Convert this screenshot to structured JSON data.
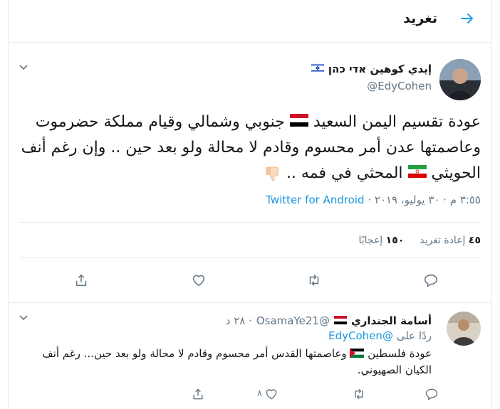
{
  "header": {
    "title": "تغريد"
  },
  "tweet": {
    "author_name": "إيدي كوهين אדי כהן",
    "author_handle": "@EdyCohen",
    "text_1": "عودة تقسيم اليمن السعيد",
    "text_2": "جنوبي وشمالي وقيام مملكة حضرموت وعاصمتها عدن أمر محسوم وقادم لا محالة ولو بعد حين .. وإن رغم أنف الحويثي",
    "text_3": "المحثي في فمه ..",
    "time": "٣:٥٥ م · ٣٠ يوليو، ٢٠١٩ ·",
    "source": "Twitter for Android",
    "retweets_count": "٤٥",
    "retweets_label": "إعادة تغريد",
    "likes_count": "١٥٠",
    "likes_label": "إعجابًا"
  },
  "reply": {
    "author_name": "أسامة الجنداري",
    "author_handle": "@OsamaYe21",
    "time": "· ٢٨ د",
    "replying_label": "ردًا على",
    "replying_to": "@EdyCohen",
    "text_1": "عودة فلسطين",
    "text_2": "وعاصمتها القدس أمر محسوم وقادم لا محالة ولو بعد حين... رغم أنف الكيان الصهيوني.",
    "likes_count": "٨"
  },
  "colors": {
    "accent": "#1da1f2",
    "link": "#1b95e0",
    "muted": "#657786",
    "border": "#e6ecf0"
  }
}
